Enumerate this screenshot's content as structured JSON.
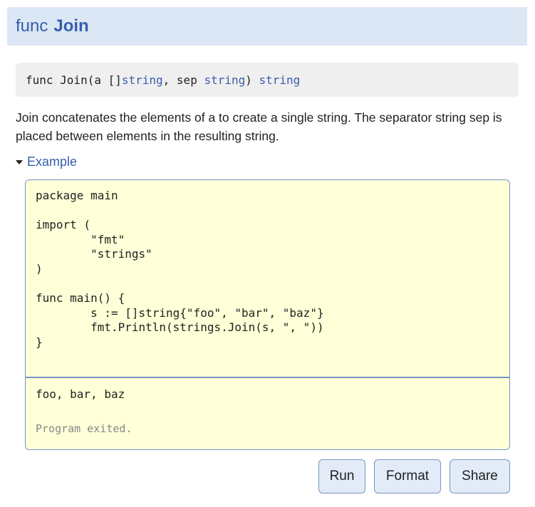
{
  "header": {
    "keyword": "func",
    "name": "Join"
  },
  "signature": {
    "prefix": "func Join(a []",
    "type1": "string",
    "mid": ", sep ",
    "type2": "string",
    "close": ") ",
    "type3": "string"
  },
  "description": "Join concatenates the elements of a to create a single string. The separator string sep is placed between elements in the resulting string.",
  "example": {
    "toggle_label": "Example",
    "code": "package main\n\nimport (\n\t\"fmt\"\n\t\"strings\"\n)\n\nfunc main() {\n\ts := []string{\"foo\", \"bar\", \"baz\"}\n\tfmt.Println(strings.Join(s, \", \"))\n}",
    "output": "foo, bar, baz",
    "status": "Program exited."
  },
  "buttons": {
    "run": "Run",
    "format": "Format",
    "share": "Share"
  },
  "colors": {
    "link": "#375eab",
    "header_bg": "#dce7f5",
    "code_bg": "#ffffd8",
    "border": "#7795c4"
  }
}
